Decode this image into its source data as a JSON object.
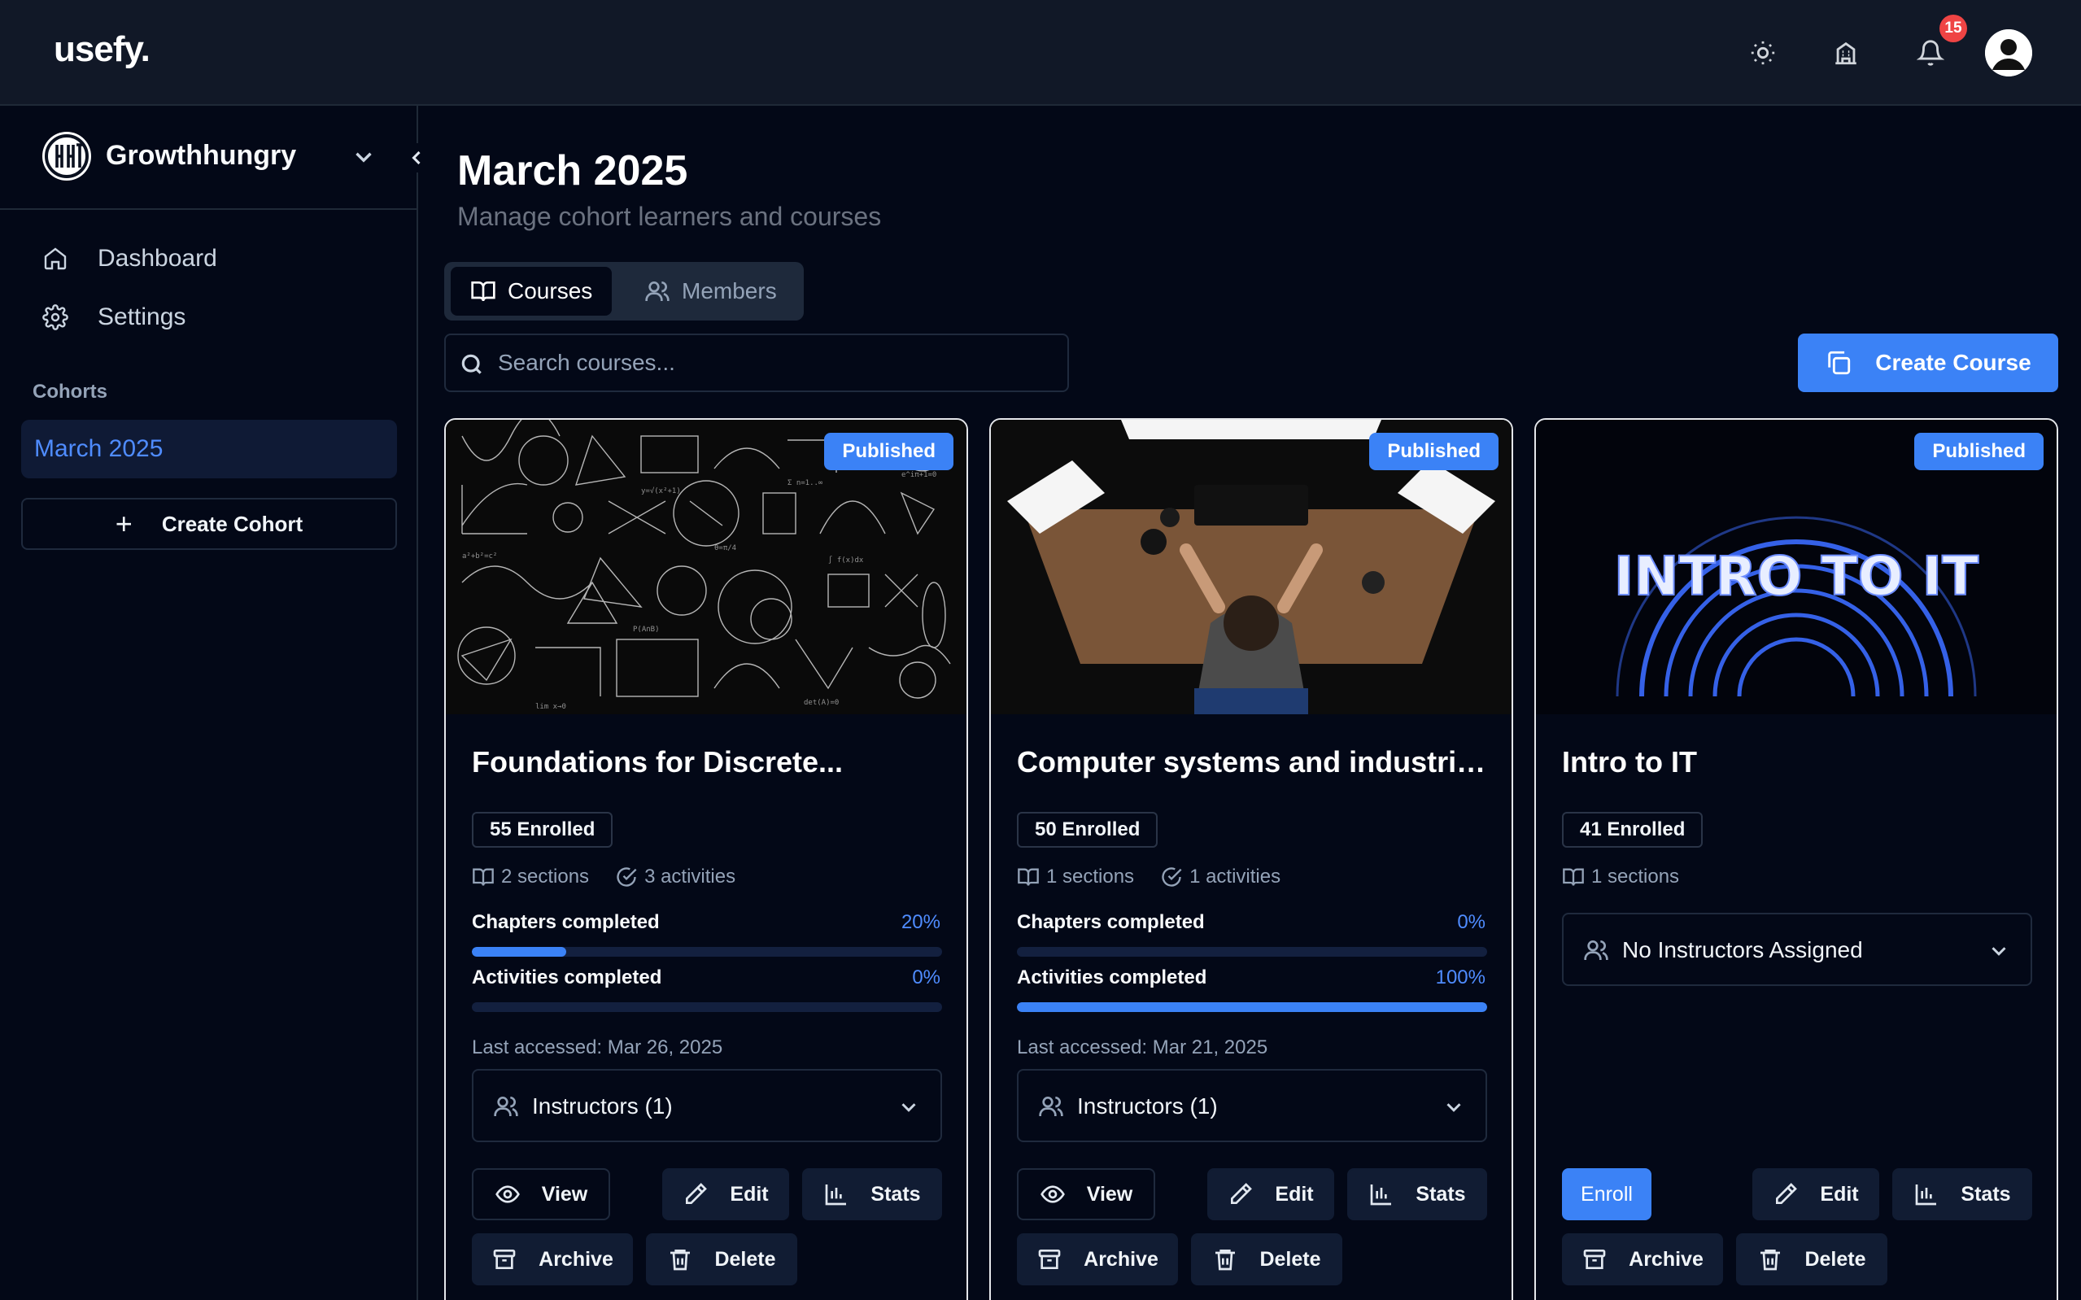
{
  "app": {
    "logo": "usefy."
  },
  "topbar": {
    "notification_count": "15",
    "icons": [
      "sun-icon",
      "building-icon",
      "bell-icon",
      "user-avatar"
    ]
  },
  "sidebar": {
    "org_name": "Growthhungry",
    "nav": [
      {
        "label": "Dashboard",
        "icon": "home-icon"
      },
      {
        "label": "Settings",
        "icon": "gear-icon"
      }
    ],
    "cohorts_heading": "Cohorts",
    "cohorts": [
      {
        "label": "March 2025",
        "active": true
      }
    ],
    "create_cohort_label": "Create Cohort"
  },
  "main": {
    "title": "March 2025",
    "subtitle": "Manage cohort learners and courses",
    "tabs": [
      {
        "label": "Courses",
        "active": true
      },
      {
        "label": "Members",
        "active": false
      }
    ],
    "search_placeholder": "Search courses...",
    "create_course_label": "Create Course"
  },
  "labels": {
    "published": "Published",
    "chapters_completed": "Chapters completed",
    "activities_completed": "Activities completed",
    "view": "View",
    "edit": "Edit",
    "stats": "Stats",
    "archive": "Archive",
    "delete": "Delete",
    "enroll": "Enroll"
  },
  "courses": [
    {
      "title": "Foundations for Discrete...",
      "enrolled": "55 Enrolled",
      "sections": "2 sections",
      "activities": "3 activities",
      "chapters_pct": "20%",
      "chapters_value": 0.2,
      "activities_pct": "0%",
      "activities_value": 0.0,
      "last_accessed": "Last accessed: Mar 26, 2025",
      "instructors": "Instructors (1)",
      "image": "math-chalkboard"
    },
    {
      "title": "Computer systems and industrial...",
      "enrolled": "50 Enrolled",
      "sections": "1 sections",
      "activities": "1 activities",
      "chapters_pct": "0%",
      "chapters_value": 0.0,
      "activities_pct": "100%",
      "activities_value": 1.0,
      "last_accessed": "Last accessed: Mar 21, 2025",
      "instructors": "Instructors (1)",
      "image": "person-at-desk"
    },
    {
      "title": "Intro to IT",
      "enrolled": "41 Enrolled",
      "sections": "1 sections",
      "instructors": "No Instructors Assigned",
      "image_text": "INTRO TO IT",
      "image": "neon-rings"
    }
  ],
  "colors": {
    "accent": "#3b82f6",
    "background": "#030817",
    "topbar": "#111827",
    "badge": "#ef4444"
  }
}
